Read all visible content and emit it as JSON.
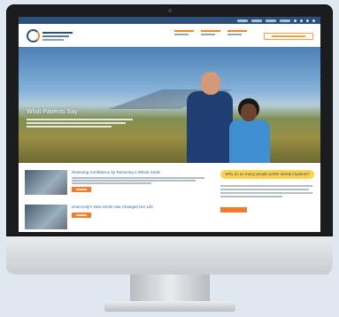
{
  "site": {
    "hero_heading": "What Patients Say",
    "articles": [
      {
        "title": "Restoring Confidence by Restoring a Whole Smile"
      },
      {
        "title": "How Kenji's New Smile Has Changed Her Life"
      }
    ],
    "sidebar_heading": "Why do so many people prefer dental implants?"
  },
  "colors": {
    "accent_orange": "#ef7d2a",
    "brand_navy": "#2c4f7c",
    "link_blue": "#2c68b0",
    "highlight_yellow": "#ffd44a"
  }
}
